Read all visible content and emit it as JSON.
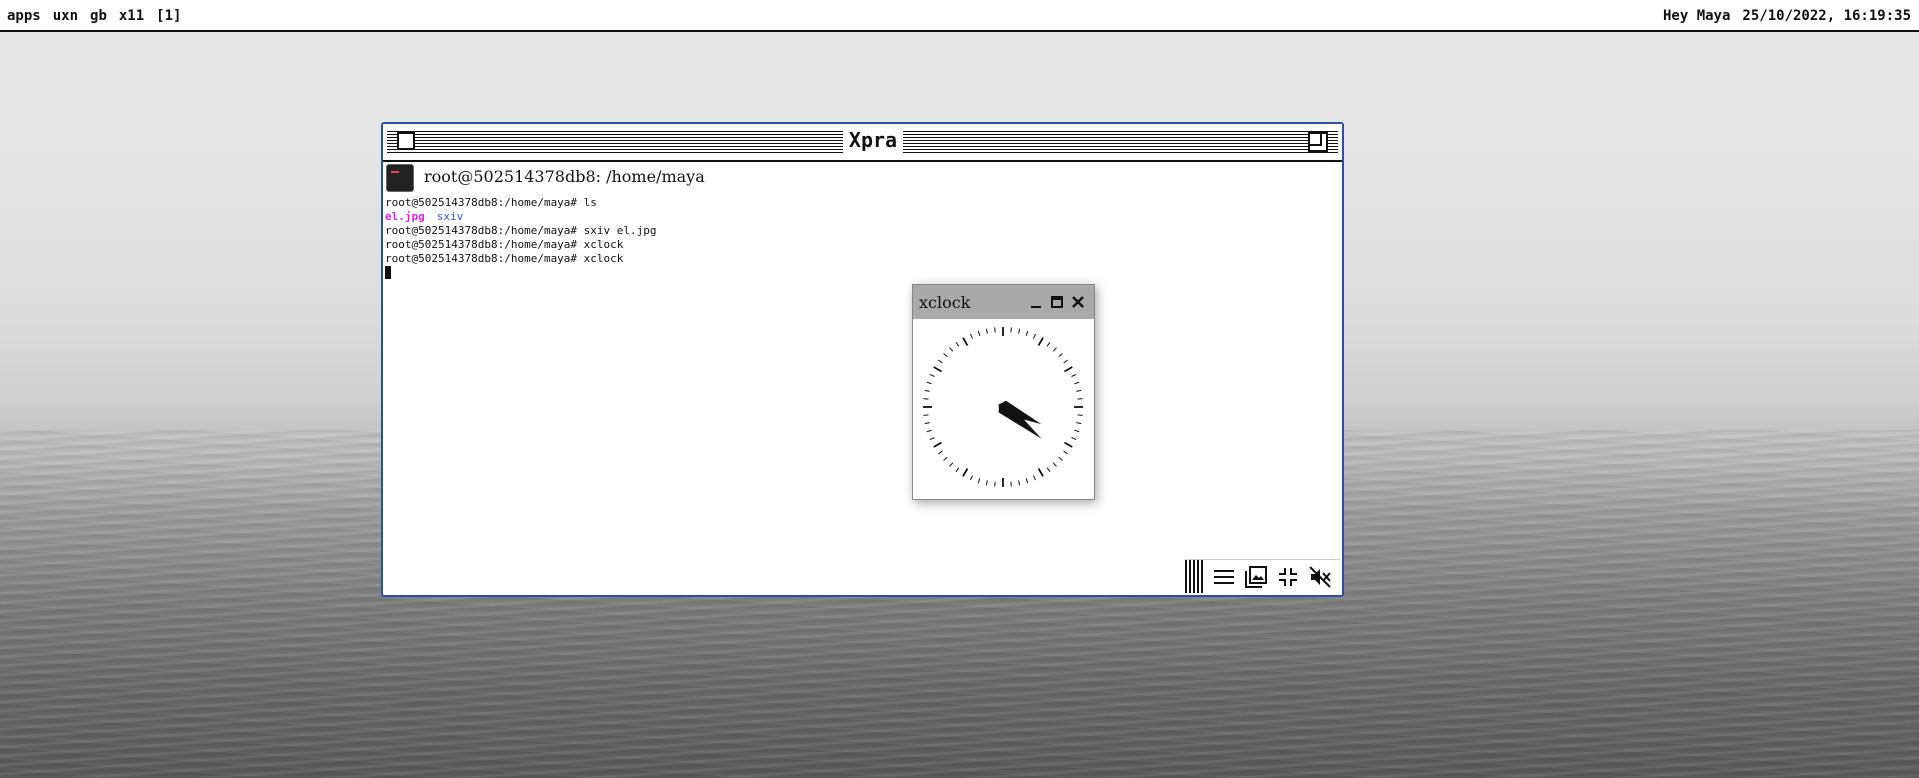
{
  "topbar": {
    "left_items": [
      "apps",
      "uxn",
      "gb",
      "x11",
      "[1]"
    ],
    "greeting": "Hey Maya",
    "datetime": "25/10/2022, 16:19:35"
  },
  "xpra_window": {
    "title": "Xpra",
    "terminal_title": "root@502514378db8: /home/maya",
    "lines": [
      "root@502514378db8:/home/maya# ls",
      "root@502514378db8:/home/maya# sxiv el.jpg",
      "root@502514378db8:/home/maya# xclock",
      "root@502514378db8:/home/maya# xclock"
    ],
    "ls_output": [
      "el.jpg",
      "sxiv"
    ],
    "tray_icons": [
      "menu-icon",
      "gallery-icon",
      "minimize-icon",
      "mute-icon"
    ]
  },
  "xclock": {
    "title": "xclock",
    "time": {
      "hour": 16,
      "minute": 19
    }
  }
}
